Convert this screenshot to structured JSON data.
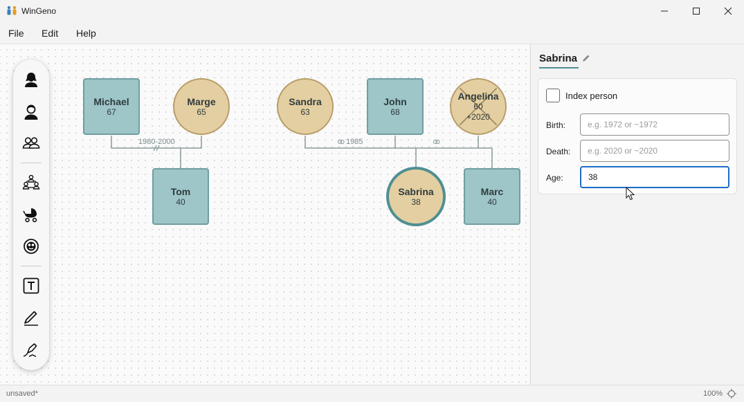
{
  "window": {
    "title": "WinGeno"
  },
  "menu": {
    "file": "File",
    "edit": "Edit",
    "help": "Help"
  },
  "toolbar": {
    "tools": [
      "add-female-icon",
      "add-male-icon",
      "add-couple-icon",
      "add-family-icon",
      "add-child-icon",
      "add-unknown-icon",
      "text-tool-icon",
      "pen-tool-icon",
      "signature-tool-icon"
    ]
  },
  "tree": {
    "persons": {
      "michael": {
        "name": "Michael",
        "age": "67"
      },
      "marge": {
        "name": "Marge",
        "age": "65"
      },
      "sandra": {
        "name": "Sandra",
        "age": "63"
      },
      "john": {
        "name": "John",
        "age": "68"
      },
      "angelina": {
        "name": "Angelina",
        "age": "60",
        "death": "+2020"
      },
      "tom": {
        "name": "Tom",
        "age": "40"
      },
      "sabrina": {
        "name": "Sabrina",
        "age": "38"
      },
      "marc": {
        "name": "Marc",
        "age": "40"
      }
    },
    "relations": {
      "michael_marge": "1980-2000",
      "sandra_john": "1985"
    }
  },
  "panel": {
    "title": "Sabrina",
    "index_person_label": "Index person",
    "index_person_checked": false,
    "birth_label": "Birth:",
    "birth_value": "",
    "birth_placeholder": "e.g. 1972 or ~1972",
    "death_label": "Death:",
    "death_value": "",
    "death_placeholder": "e.g. 2020 or ~2020",
    "age_label": "Age:",
    "age_value": "38"
  },
  "status": {
    "text": "unsaved*",
    "zoom": "100%"
  },
  "colors": {
    "male_fill": "#9ec5c8",
    "female_fill": "#e4cfa2",
    "accent": "#4f8f92",
    "focus": "#1a6ec7"
  }
}
